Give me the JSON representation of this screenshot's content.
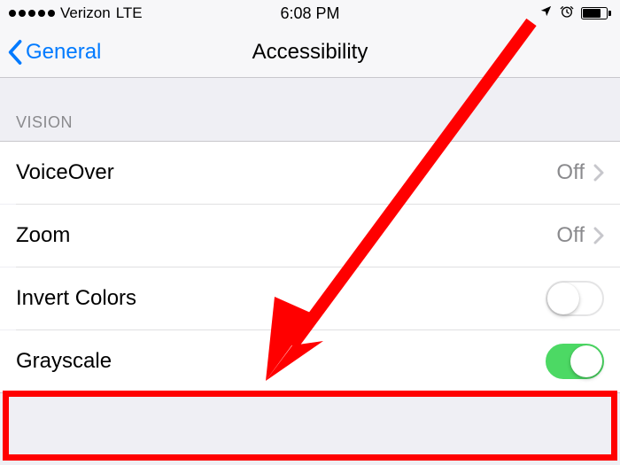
{
  "status": {
    "carrier": "Verizon",
    "network": "LTE",
    "time": "6:08 PM"
  },
  "nav": {
    "back_label": "General",
    "title": "Accessibility"
  },
  "section": {
    "vision_label": "VISION"
  },
  "rows": {
    "voiceover": {
      "label": "VoiceOver",
      "value": "Off"
    },
    "zoom": {
      "label": "Zoom",
      "value": "Off"
    },
    "invert": {
      "label": "Invert Colors",
      "toggle": "off"
    },
    "grayscale": {
      "label": "Grayscale",
      "toggle": "on"
    }
  },
  "colors": {
    "accent_blue": "#007aff",
    "toggle_green": "#4cd964",
    "annotation_red": "#ff0000"
  }
}
